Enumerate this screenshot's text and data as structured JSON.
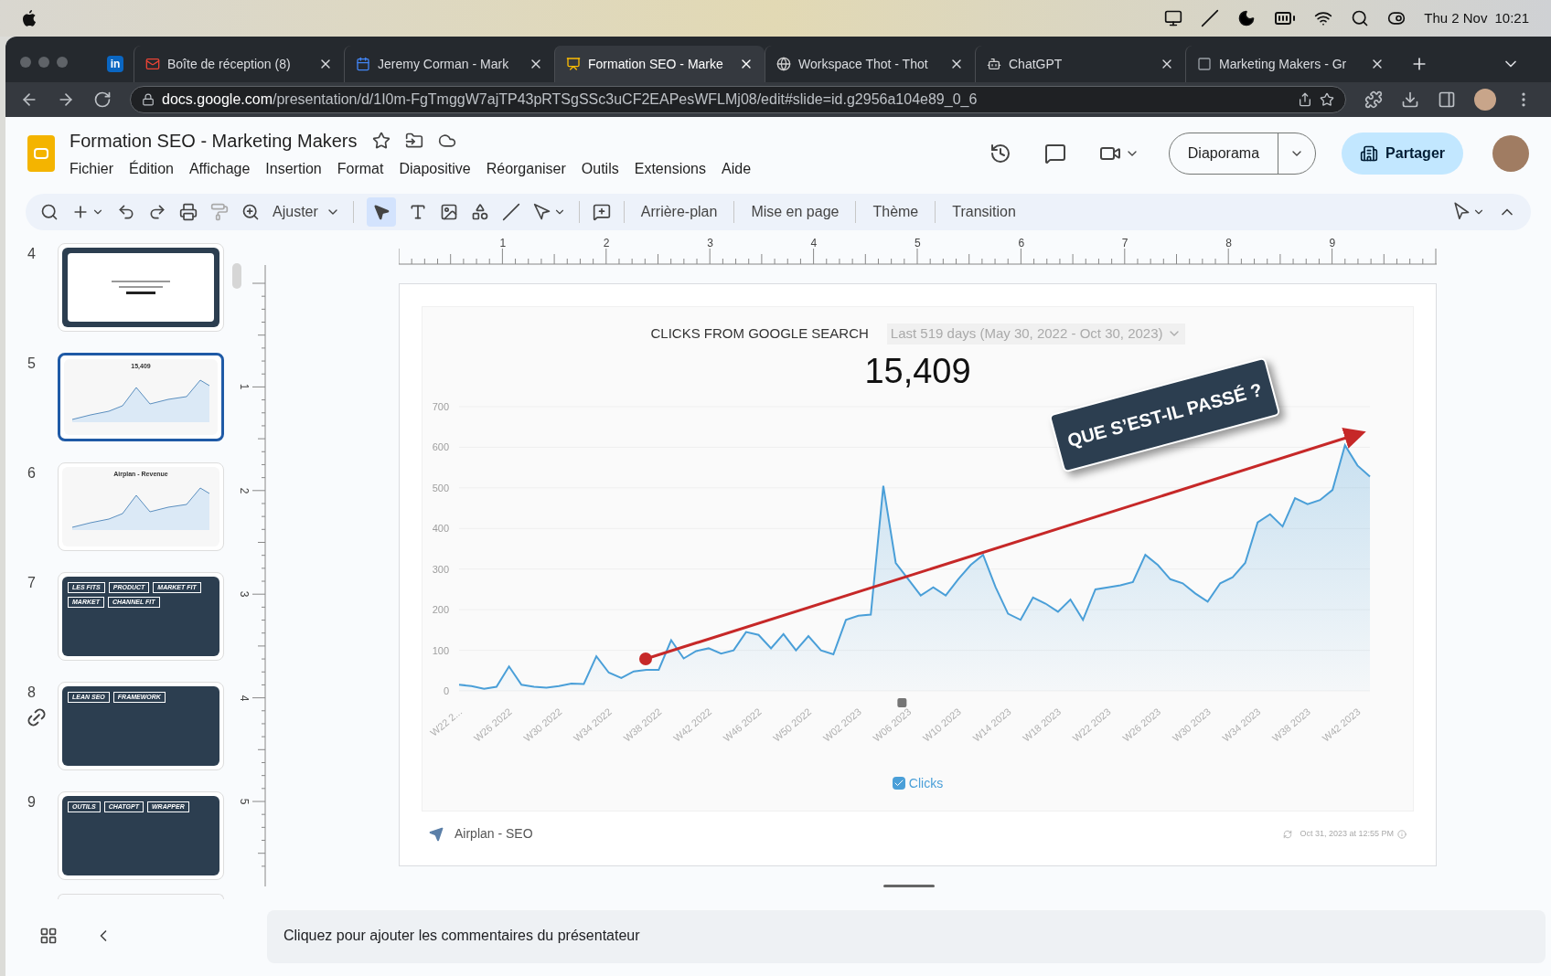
{
  "menubar": {
    "date": "Thu 2 Nov",
    "time": "10:21"
  },
  "browser": {
    "tabs": [
      {
        "kind": "pinned",
        "icon_text": "in",
        "selected": false
      },
      {
        "kind": "mail",
        "title": "Boîte de réception (8)",
        "selected": false
      },
      {
        "kind": "calendar",
        "title": "Jeremy Corman - Mark",
        "selected": false
      },
      {
        "kind": "slides",
        "title": "Formation SEO - Marke",
        "selected": true
      },
      {
        "kind": "globe",
        "title": "Workspace Thot - Thot",
        "selected": false
      },
      {
        "kind": "chat",
        "title": "ChatGPT",
        "selected": false
      },
      {
        "kind": "brand",
        "title": "Marketing Makers - Gr",
        "selected": false
      }
    ],
    "url_host": "docs.google.com",
    "url_path": "/presentation/d/1I0m-FgTmggW7ajTP43pRTSgSSc3uCF2EAPesWFLMj08/edit#slide=id.g2956a104e89_0_6"
  },
  "header": {
    "title": "Formation SEO - Marketing Makers",
    "menus": [
      "Fichier",
      "Édition",
      "Affichage",
      "Insertion",
      "Format",
      "Diapositive",
      "Réorganiser",
      "Outils",
      "Extensions",
      "Aide"
    ],
    "slideshow": "Diaporama",
    "share": "Partager"
  },
  "toolbar": {
    "zoom": "Ajuster",
    "pointer_selected": true,
    "text_buttons": [
      "Arrière-plan",
      "Mise en page",
      "Thème",
      "Transition"
    ]
  },
  "filmstrip": [
    {
      "number": "4",
      "kind": "screenshot",
      "selected": false
    },
    {
      "number": "5",
      "kind": "chart",
      "selected": true,
      "labels": [
        "15,409"
      ]
    },
    {
      "number": "6",
      "kind": "chart",
      "selected": false,
      "labels": [
        "Airplan - Revenue"
      ]
    },
    {
      "number": "7",
      "kind": "cards",
      "selected": false,
      "labels": [
        "LES FITS",
        "PRODUCT",
        "MARKET FIT",
        "MARKET",
        "CHANNEL FIT"
      ]
    },
    {
      "number": "8",
      "kind": "cards",
      "selected": false,
      "labels": [
        "LEAN SEO",
        "FRAMEWORK"
      ]
    },
    {
      "number": "9",
      "kind": "cards",
      "selected": false,
      "labels": [
        "OUTILS",
        "CHATGPT",
        "WRAPPER"
      ]
    }
  ],
  "rulers": {
    "horizontal": [
      "1",
      "2",
      "3",
      "4",
      "5",
      "6",
      "7",
      "8",
      "9"
    ],
    "vertical": [
      "1",
      "2",
      "3",
      "4",
      "5"
    ]
  },
  "slide": {
    "chart_title": "CLICKS FROM GOOGLE SEARCH",
    "date_range": "Last 519 days (May 30, 2022 - Oct 30, 2023)",
    "total": "15,409",
    "chart_data": {
      "type": "area",
      "categories": [
        "W22 2...",
        null,
        null,
        null,
        "W26 2022",
        null,
        null,
        null,
        "W30 2022",
        null,
        null,
        null,
        "W34 2022",
        null,
        null,
        null,
        "W38 2022",
        null,
        null,
        null,
        "W42 2022",
        null,
        null,
        null,
        "W46 2022",
        null,
        null,
        null,
        "W50 2022",
        null,
        null,
        null,
        "W02 2023",
        null,
        null,
        null,
        "W06 2023",
        null,
        null,
        null,
        "W10 2023",
        null,
        null,
        null,
        "W14 2023",
        null,
        null,
        null,
        "W18 2023",
        null,
        null,
        null,
        "W22 2023",
        null,
        null,
        null,
        "W26 2023",
        null,
        null,
        null,
        "W30 2023",
        null,
        null,
        null,
        "W34 2023",
        null,
        null,
        null,
        "W38 2023",
        null,
        null,
        null,
        "W42 2023",
        null
      ],
      "series": [
        {
          "name": "Clicks",
          "color": "#4a9fd8",
          "values": [
            15,
            12,
            5,
            10,
            60,
            15,
            10,
            8,
            12,
            18,
            17,
            85,
            45,
            32,
            48,
            52,
            52,
            125,
            80,
            98,
            105,
            92,
            100,
            145,
            138,
            105,
            140,
            100,
            135,
            100,
            90,
            175,
            185,
            188,
            505,
            315,
            275,
            235,
            255,
            235,
            275,
            310,
            335,
            255,
            190,
            175,
            230,
            215,
            195,
            225,
            175,
            250,
            255,
            260,
            268,
            335,
            310,
            275,
            265,
            240,
            220,
            265,
            280,
            315,
            415,
            435,
            405,
            475,
            460,
            470,
            495,
            605,
            555,
            528
          ]
        }
      ],
      "ylim": [
        0,
        700
      ],
      "grid": true,
      "yticks": [
        0,
        100,
        200,
        300,
        400,
        500,
        600,
        700
      ],
      "annotations": [
        {
          "text": "QUE S’EST-IL PASSÉ ?"
        }
      ]
    },
    "legend_checked": true,
    "source": "Airplan - SEO",
    "timestamp": "Oct 31, 2023 at 12:55 PM"
  },
  "notes": {
    "placeholder": "Cliquez pour ajouter les commentaires du présentateur"
  }
}
